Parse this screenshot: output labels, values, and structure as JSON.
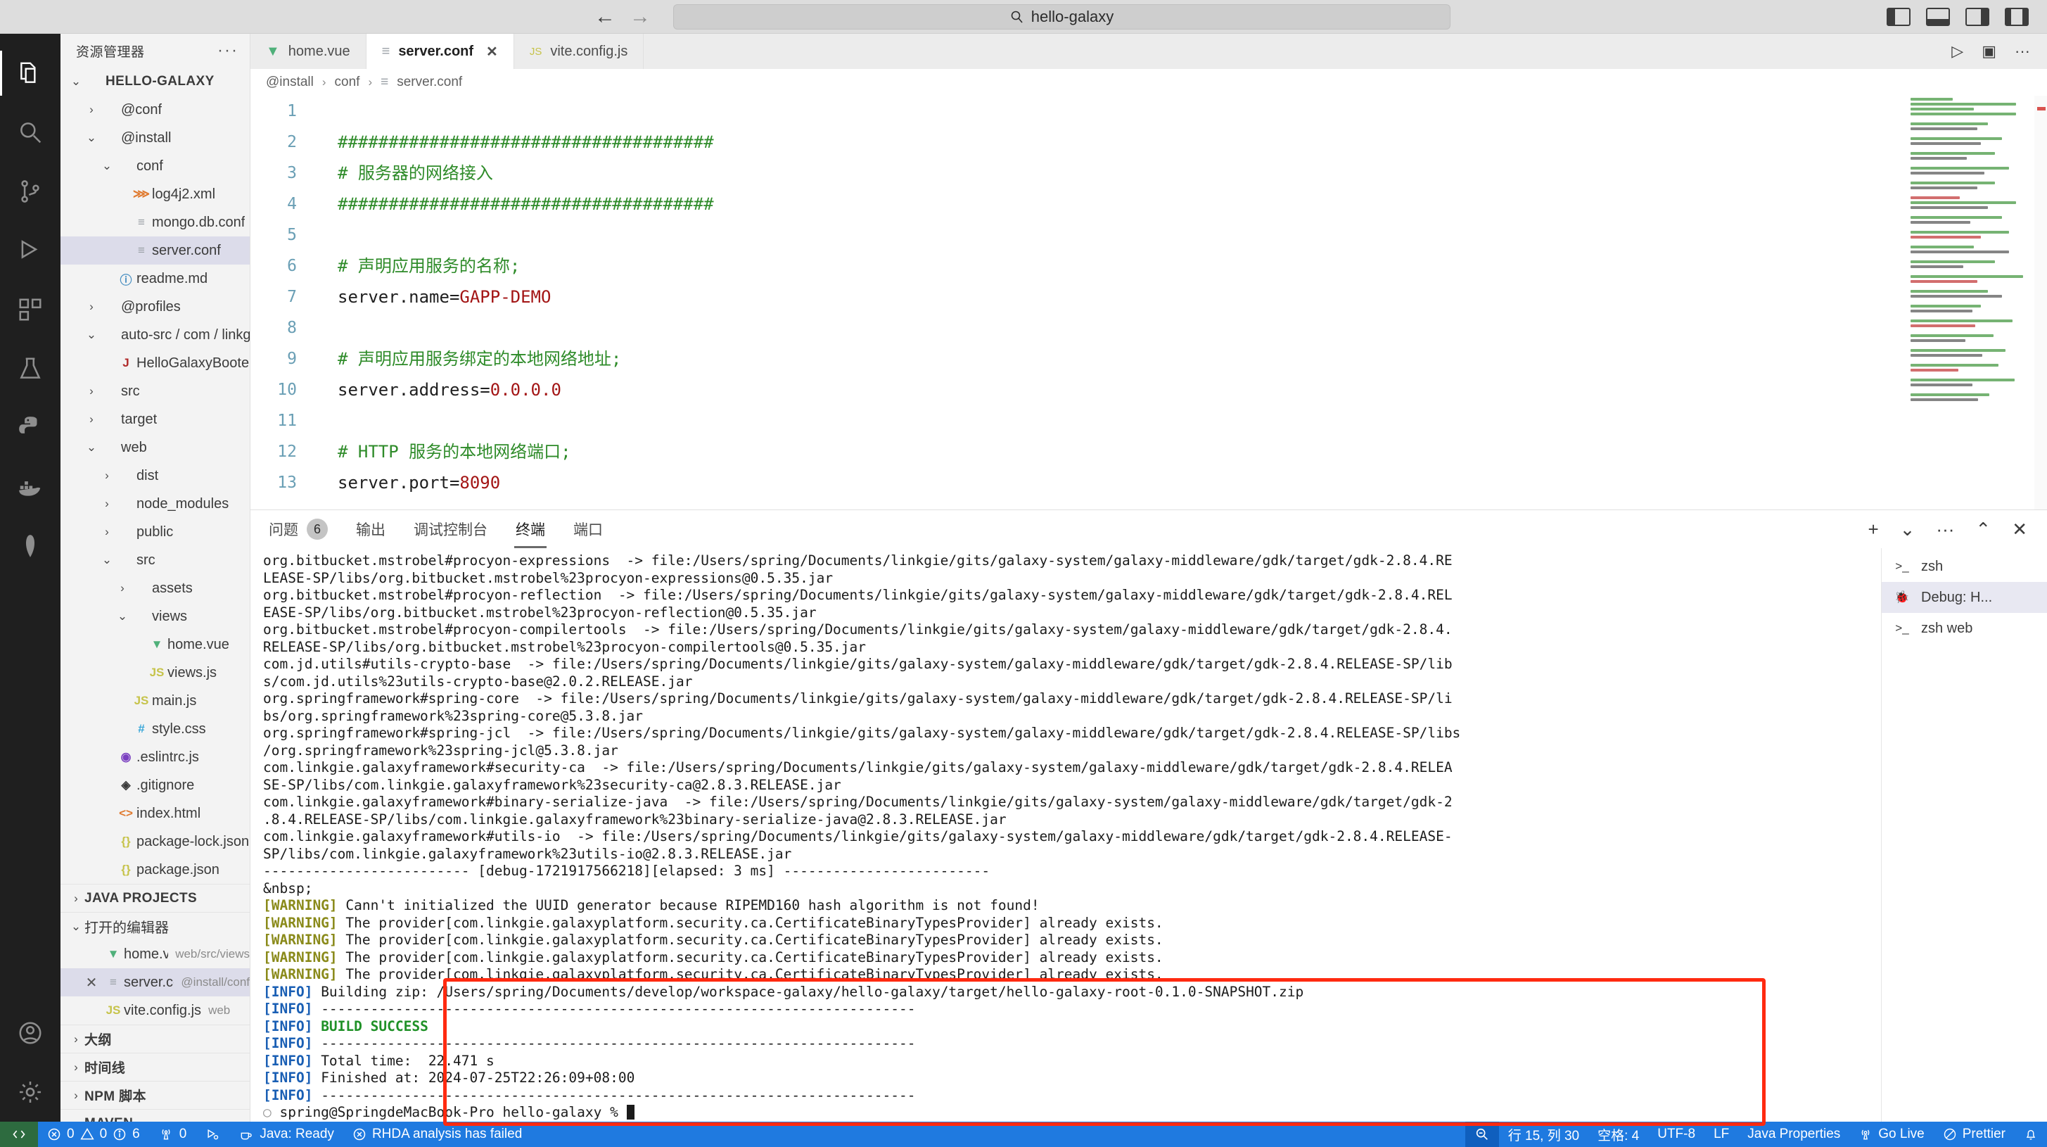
{
  "titlebar": {
    "back_icon": "arrow-left",
    "forward_icon": "arrow-right",
    "search_icon": "search-icon",
    "search_text": "hello-galaxy"
  },
  "activitybar": {
    "items": [
      {
        "name": "explorer",
        "icon": "files-icon"
      },
      {
        "name": "search",
        "icon": "search-icon"
      },
      {
        "name": "source-control",
        "icon": "branch-icon"
      },
      {
        "name": "extensions",
        "icon": "extensions-icon"
      },
      {
        "name": "testing",
        "icon": "beaker-icon"
      },
      {
        "name": "python",
        "icon": "python-icon"
      },
      {
        "name": "docker",
        "icon": "docker-icon"
      },
      {
        "name": "database",
        "icon": "database-icon"
      }
    ],
    "bottom": [
      {
        "name": "account",
        "icon": "account-icon"
      },
      {
        "name": "settings",
        "icon": "gear-icon"
      }
    ]
  },
  "sidebar": {
    "title": "资源管理器",
    "more_label": "···",
    "tree": [
      {
        "indent": 0,
        "twisty": "v",
        "icon": "",
        "label": "HELLO-GALAXY",
        "bold": true
      },
      {
        "indent": 1,
        "twisty": ">",
        "icon": "",
        "label": "@conf"
      },
      {
        "indent": 1,
        "twisty": "v",
        "icon": "",
        "label": "@install"
      },
      {
        "indent": 2,
        "twisty": "v",
        "icon": "",
        "label": "conf"
      },
      {
        "indent": 3,
        "twisty": "",
        "icon": "xml",
        "label": "log4j2.xml"
      },
      {
        "indent": 3,
        "twisty": "",
        "icon": "conf",
        "label": "mongo.db.conf"
      },
      {
        "indent": 3,
        "twisty": "",
        "icon": "conf",
        "label": "server.conf",
        "selected": true
      },
      {
        "indent": 2,
        "twisty": "",
        "icon": "md",
        "label": "readme.md"
      },
      {
        "indent": 1,
        "twisty": ">",
        "icon": "",
        "label": "@profiles"
      },
      {
        "indent": 1,
        "twisty": "v",
        "icon": "",
        "label": "auto-src / com / linkgie / galaxyframew..."
      },
      {
        "indent": 2,
        "twisty": "",
        "icon": "java",
        "label": "HelloGalaxyBooter.java"
      },
      {
        "indent": 1,
        "twisty": ">",
        "icon": "",
        "label": "src"
      },
      {
        "indent": 1,
        "twisty": ">",
        "icon": "",
        "label": "target"
      },
      {
        "indent": 1,
        "twisty": "v",
        "icon": "",
        "label": "web"
      },
      {
        "indent": 2,
        "twisty": ">",
        "icon": "",
        "label": "dist"
      },
      {
        "indent": 2,
        "twisty": ">",
        "icon": "",
        "label": "node_modules"
      },
      {
        "indent": 2,
        "twisty": ">",
        "icon": "",
        "label": "public"
      },
      {
        "indent": 2,
        "twisty": "v",
        "icon": "",
        "label": "src"
      },
      {
        "indent": 3,
        "twisty": ">",
        "icon": "",
        "label": "assets"
      },
      {
        "indent": 3,
        "twisty": "v",
        "icon": "",
        "label": "views"
      },
      {
        "indent": 4,
        "twisty": "",
        "icon": "vue",
        "label": "home.vue"
      },
      {
        "indent": 4,
        "twisty": "",
        "icon": "js",
        "label": "views.js"
      },
      {
        "indent": 3,
        "twisty": "",
        "icon": "js",
        "label": "main.js"
      },
      {
        "indent": 3,
        "twisty": "",
        "icon": "css",
        "label": "style.css"
      },
      {
        "indent": 2,
        "twisty": "",
        "icon": "eslint",
        "label": ".eslintrc.js"
      },
      {
        "indent": 2,
        "twisty": "",
        "icon": "git",
        "label": ".gitignore"
      },
      {
        "indent": 2,
        "twisty": "",
        "icon": "html",
        "label": "index.html"
      },
      {
        "indent": 2,
        "twisty": "",
        "icon": "json",
        "label": "package-lock.json"
      },
      {
        "indent": 2,
        "twisty": "",
        "icon": "json",
        "label": "package.json"
      }
    ],
    "sections": [
      {
        "twisty": ">",
        "label": "JAVA PROJECTS",
        "bold": true
      },
      {
        "twisty": "v",
        "label": "打开的编辑器",
        "bold": false
      }
    ],
    "open_editors": [
      {
        "icon": "vue",
        "label": "home.vue",
        "sub": "web/src/views",
        "close": false
      },
      {
        "icon": "conf",
        "label": "server.conf",
        "sub": "@install/conf",
        "close": true,
        "selected": true
      },
      {
        "icon": "js",
        "label": "vite.config.js",
        "sub": "web",
        "close": false
      }
    ],
    "bottom_sections": [
      {
        "twisty": ">",
        "label": "大纲",
        "bold": true
      },
      {
        "twisty": ">",
        "label": "时间线",
        "bold": true
      },
      {
        "twisty": ">",
        "label": "NPM 脚本",
        "bold": true
      },
      {
        "twisty": ">",
        "label": "MAVEN",
        "bold": true
      }
    ]
  },
  "editor": {
    "tabs": [
      {
        "icon": "vue",
        "label": "home.vue",
        "active": false,
        "close": false
      },
      {
        "icon": "conf",
        "label": "server.conf",
        "active": true,
        "close": true
      },
      {
        "icon": "js",
        "label": "vite.config.js",
        "active": false,
        "close": false
      }
    ],
    "actions": [
      {
        "name": "run-icon",
        "glyph": "▷"
      },
      {
        "name": "split-editor-icon",
        "glyph": "▣"
      },
      {
        "name": "more-actions-icon",
        "glyph": "···"
      }
    ],
    "breadcrumbs": [
      "@install",
      "conf",
      "server.conf"
    ],
    "lines": [
      {
        "n": 1,
        "parts": []
      },
      {
        "n": 2,
        "parts": [
          {
            "t": "#####################################",
            "c": "comment"
          }
        ]
      },
      {
        "n": 3,
        "parts": [
          {
            "t": "# 服务器的网络接入",
            "c": "comment"
          }
        ]
      },
      {
        "n": 4,
        "parts": [
          {
            "t": "#####################################",
            "c": "comment"
          }
        ]
      },
      {
        "n": 5,
        "parts": []
      },
      {
        "n": 6,
        "parts": [
          {
            "t": "# 声明应用服务的名称;",
            "c": "comment"
          }
        ]
      },
      {
        "n": 7,
        "parts": [
          {
            "t": "server.name=",
            "c": "key"
          },
          {
            "t": "GAPP-DEMO",
            "c": "val"
          }
        ]
      },
      {
        "n": 8,
        "parts": []
      },
      {
        "n": 9,
        "parts": [
          {
            "t": "# 声明应用服务绑定的本地网络地址;",
            "c": "comment"
          }
        ]
      },
      {
        "n": 10,
        "parts": [
          {
            "t": "server.address=",
            "c": "key"
          },
          {
            "t": "0.0.0.0",
            "c": "val"
          }
        ]
      },
      {
        "n": 11,
        "parts": []
      },
      {
        "n": 12,
        "parts": [
          {
            "t": "# HTTP 服务的本地网络端口;",
            "c": "comment"
          }
        ]
      },
      {
        "n": 13,
        "parts": [
          {
            "t": "server.port=",
            "c": "key"
          },
          {
            "t": "8090",
            "c": "val"
          }
        ]
      }
    ]
  },
  "panel": {
    "tabs": [
      {
        "label": "问题",
        "badge": "6",
        "active": false
      },
      {
        "label": "输出",
        "badge": "",
        "active": false
      },
      {
        "label": "调试控制台",
        "badge": "",
        "active": false
      },
      {
        "label": "终端",
        "badge": "",
        "active": true
      },
      {
        "label": "端口",
        "badge": "",
        "active": false
      }
    ],
    "actions": [
      {
        "name": "new-terminal-icon",
        "glyph": "+"
      },
      {
        "name": "terminal-dropdown-icon",
        "glyph": "⌄"
      },
      {
        "name": "panel-more-icon",
        "glyph": "···"
      },
      {
        "name": "maximize-panel-icon",
        "glyph": "⌃"
      },
      {
        "name": "close-panel-icon",
        "glyph": "✕"
      }
    ],
    "terminal_list": [
      {
        "icon": "terminal-icon",
        "label": "zsh",
        "active": false
      },
      {
        "icon": "bug-icon",
        "label": "Debug: H...",
        "active": true
      },
      {
        "icon": "terminal-icon",
        "label": "zsh  web",
        "active": false
      }
    ],
    "terminal_lines": [
      {
        "kind": "plain",
        "text": "org.bitbucket.mstrobel#procyon-expressions  -> file:/Users/spring/Documents/linkgie/gits/galaxy-system/galaxy-middleware/gdk/target/gdk-2.8.4.RE"
      },
      {
        "kind": "plain",
        "text": "LEASE-SP/libs/org.bitbucket.mstrobel%23procyon-expressions@0.5.35.jar"
      },
      {
        "kind": "plain",
        "text": "org.bitbucket.mstrobel#procyon-reflection  -> file:/Users/spring/Documents/linkgie/gits/galaxy-system/galaxy-middleware/gdk/target/gdk-2.8.4.REL"
      },
      {
        "kind": "plain",
        "text": "EASE-SP/libs/org.bitbucket.mstrobel%23procyon-reflection@0.5.35.jar"
      },
      {
        "kind": "plain",
        "text": "org.bitbucket.mstrobel#procyon-compilertools  -> file:/Users/spring/Documents/linkgie/gits/galaxy-system/galaxy-middleware/gdk/target/gdk-2.8.4."
      },
      {
        "kind": "plain",
        "text": "RELEASE-SP/libs/org.bitbucket.mstrobel%23procyon-compilertools@0.5.35.jar"
      },
      {
        "kind": "plain",
        "text": "com.jd.utils#utils-crypto-base  -> file:/Users/spring/Documents/linkgie/gits/galaxy-system/galaxy-middleware/gdk/target/gdk-2.8.4.RELEASE-SP/lib"
      },
      {
        "kind": "plain",
        "text": "s/com.jd.utils%23utils-crypto-base@2.0.2.RELEASE.jar"
      },
      {
        "kind": "plain",
        "text": "org.springframework#spring-core  -> file:/Users/spring/Documents/linkgie/gits/galaxy-system/galaxy-middleware/gdk/target/gdk-2.8.4.RELEASE-SP/li"
      },
      {
        "kind": "plain",
        "text": "bs/org.springframework%23spring-core@5.3.8.jar"
      },
      {
        "kind": "plain",
        "text": "org.springframework#spring-jcl  -> file:/Users/spring/Documents/linkgie/gits/galaxy-system/galaxy-middleware/gdk/target/gdk-2.8.4.RELEASE-SP/libs"
      },
      {
        "kind": "plain",
        "text": "/org.springframework%23spring-jcl@5.3.8.jar"
      },
      {
        "kind": "plain",
        "text": "com.linkgie.galaxyframework#security-ca  -> file:/Users/spring/Documents/linkgie/gits/galaxy-system/galaxy-middleware/gdk/target/gdk-2.8.4.RELEA"
      },
      {
        "kind": "plain",
        "text": "SE-SP/libs/com.linkgie.galaxyframework%23security-ca@2.8.3.RELEASE.jar"
      },
      {
        "kind": "plain",
        "text": "com.linkgie.galaxyframework#binary-serialize-java  -> file:/Users/spring/Documents/linkgie/gits/galaxy-system/galaxy-middleware/gdk/target/gdk-2"
      },
      {
        "kind": "plain",
        "text": ".8.4.RELEASE-SP/libs/com.linkgie.galaxyframework%23binary-serialize-java@2.8.3.RELEASE.jar"
      },
      {
        "kind": "plain",
        "text": "com.linkgie.galaxyframework#utils-io  -> file:/Users/spring/Documents/linkgie/gits/galaxy-system/galaxy-middleware/gdk/target/gdk-2.8.4.RELEASE-"
      },
      {
        "kind": "plain",
        "text": "SP/libs/com.linkgie.galaxyframework%23utils-io@2.8.3.RELEASE.jar"
      },
      {
        "kind": "plain",
        "text": "------------------------- [debug-1721917566218][elapsed: 3 ms] -------------------------"
      },
      {
        "kind": "blank",
        "text": ""
      },
      {
        "kind": "warning",
        "tag": "[WARNING]",
        "text": " Cann't initialized the UUID generator because RIPEMD160 hash algorithm is not found!"
      },
      {
        "kind": "warning",
        "tag": "[WARNING]",
        "text": " The provider[com.linkgie.galaxyplatform.security.ca.CertificateBinaryTypesProvider] already exists."
      },
      {
        "kind": "warning",
        "tag": "[WARNING]",
        "text": " The provider[com.linkgie.galaxyplatform.security.ca.CertificateBinaryTypesProvider] already exists."
      },
      {
        "kind": "warning",
        "tag": "[WARNING]",
        "text": " The provider[com.linkgie.galaxyplatform.security.ca.CertificateBinaryTypesProvider] already exists."
      },
      {
        "kind": "warning",
        "tag": "[WARNING]",
        "text": " The provider[com.linkgie.galaxyplatform.security.ca.CertificateBinaryTypesProvider] already exists."
      },
      {
        "kind": "info",
        "tag": "[INFO]",
        "text": " Building zip: /Users/spring/Documents/develop/workspace-galaxy/hello-galaxy/target/hello-galaxy-root-0.1.0-SNAPSHOT.zip"
      },
      {
        "kind": "info",
        "tag": "[INFO]",
        "text": " ------------------------------------------------------------------------"
      },
      {
        "kind": "info-success",
        "tag": "[INFO]",
        "text": " BUILD SUCCESS"
      },
      {
        "kind": "info",
        "tag": "[INFO]",
        "text": " ------------------------------------------------------------------------"
      },
      {
        "kind": "info",
        "tag": "[INFO]",
        "text": " Total time:  22.471 s"
      },
      {
        "kind": "info",
        "tag": "[INFO]",
        "text": " Finished at: 2024-07-25T22:26:09+08:00"
      },
      {
        "kind": "info",
        "tag": "[INFO]",
        "text": " ------------------------------------------------------------------------"
      },
      {
        "kind": "prompt",
        "text": "spring@SpringdeMacBook-Pro hello-galaxy % "
      }
    ]
  },
  "statusbar": {
    "remote_icon": "remote-icon",
    "left": [
      {
        "name": "errors-warnings",
        "icon": "error-icon",
        "text": "0",
        "icon2": "warning-icon",
        "text2": "0",
        "icon3": "info-icon",
        "text3": "6"
      },
      {
        "name": "radio-tower",
        "icon": "radio-tower-icon",
        "text": "0"
      },
      {
        "name": "debug-alt",
        "icon": "debug-icon",
        "text": ""
      },
      {
        "name": "java-ready",
        "icon": "coffee-icon",
        "text": "Java: Ready"
      },
      {
        "name": "rhda-status",
        "icon": "error-icon",
        "text": "RHDA analysis has failed"
      }
    ],
    "right": [
      {
        "name": "zoom",
        "icon": "zoom-icon",
        "text": ""
      },
      {
        "name": "cursor-position",
        "text": "行 15, 列 30"
      },
      {
        "name": "indentation",
        "text": "空格: 4"
      },
      {
        "name": "encoding",
        "text": "UTF-8"
      },
      {
        "name": "eol",
        "text": "LF"
      },
      {
        "name": "language-mode",
        "text": "Java Properties"
      },
      {
        "name": "go-live",
        "icon": "broadcast-icon",
        "text": "Go Live"
      },
      {
        "name": "prettier",
        "icon": "prettier-icon",
        "text": "Prettier"
      },
      {
        "name": "notifications",
        "icon": "bell-icon",
        "text": ""
      }
    ]
  },
  "colors": {
    "accent_blue": "#1f7ae0",
    "remote_green": "#2d6b3f",
    "highlight_box": "#ff2a10",
    "comment_green": "#2e8b29",
    "value_red": "#a31515",
    "success_green": "#1f9127"
  }
}
